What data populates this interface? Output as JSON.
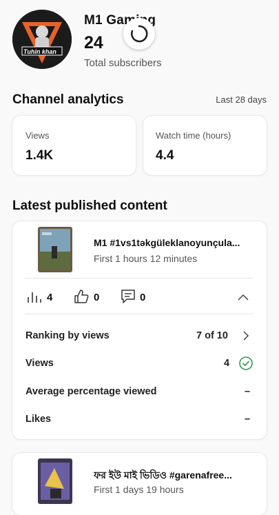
{
  "channel": {
    "name": "M1 Gaming",
    "avatar_text": "Tuhin khan",
    "subscriber_count": "24",
    "subscriber_label": "Total subscribers"
  },
  "analytics": {
    "title": "Channel analytics",
    "range": "Last 28 days",
    "cards": [
      {
        "label": "Views",
        "value": "1.4K"
      },
      {
        "label": "Watch time (hours)",
        "value": "4.4"
      }
    ]
  },
  "latest": {
    "title": "Latest published content",
    "items": [
      {
        "title": "M1 #1vs1təkgüleklanoyunçula...",
        "subtitle": "First 1 hours 12 minutes",
        "views": "4",
        "likes": "0",
        "comments": "0",
        "rows": [
          {
            "label": "Ranking by views",
            "value": "7 of 10"
          },
          {
            "label": "Views",
            "value": "4"
          },
          {
            "label": "Average percentage viewed",
            "value": "–"
          },
          {
            "label": "Likes",
            "value": "–"
          }
        ]
      },
      {
        "title": "ফর ইউ মাই ভিডিও #garenafree...",
        "subtitle": "First 1 days 19 hours"
      }
    ]
  },
  "colors": {
    "accent_green": "#2e9e4f",
    "avatar_orange": "#e8622a"
  }
}
